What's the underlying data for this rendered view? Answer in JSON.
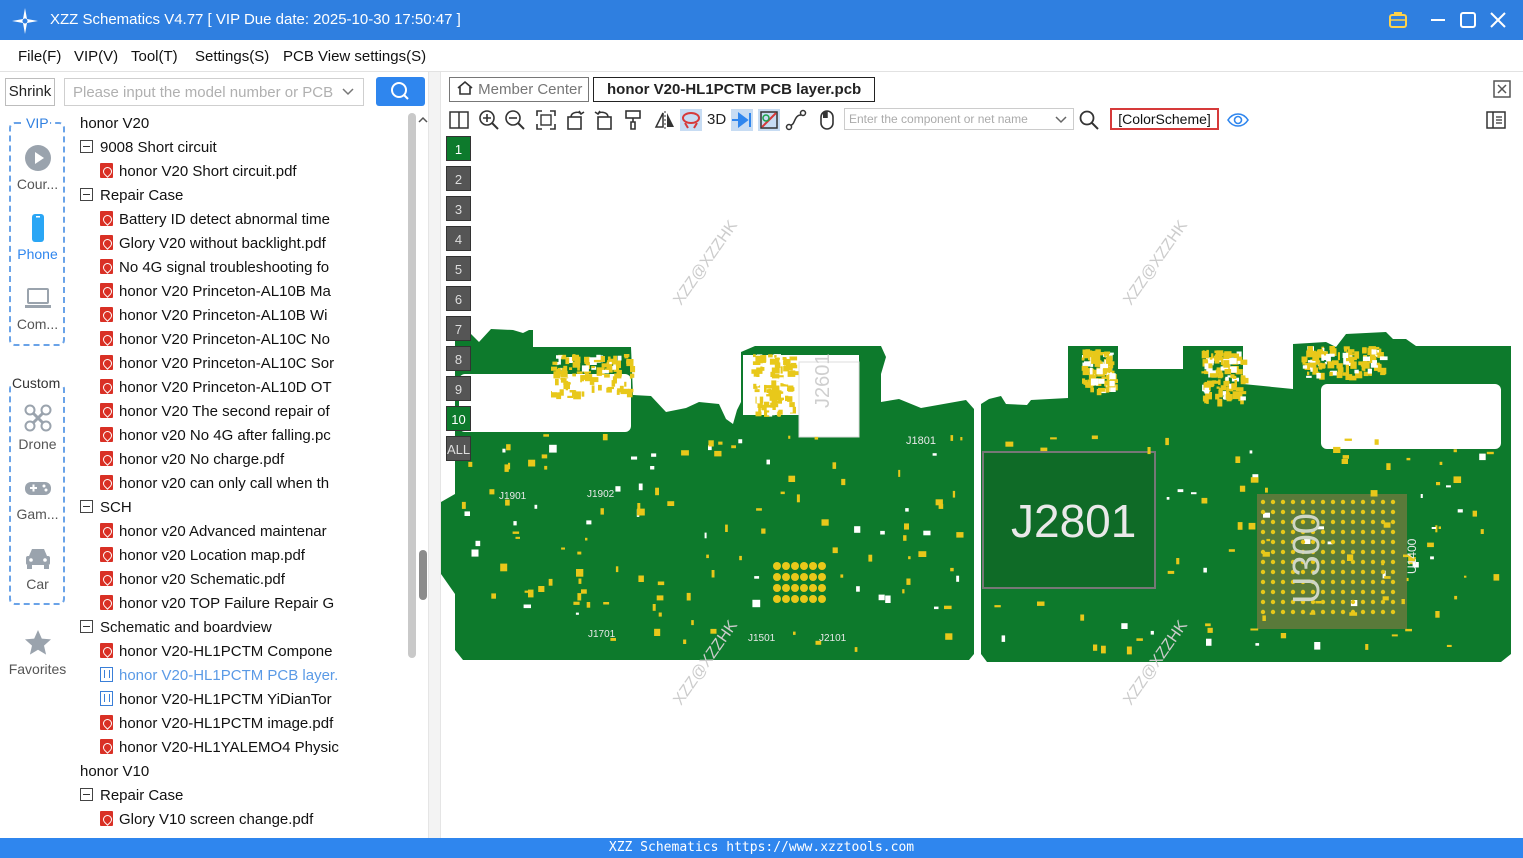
{
  "window": {
    "title": "XZZ Schematics V4.77 [ VIP Due date: 2025-10-30 17:50:47 ]"
  },
  "menu": {
    "file": "File(F)",
    "vip": "VIP(V)",
    "tool": "Tool(T)",
    "settings": "Settings(S)",
    "pcb_view": "PCB View settings(S)"
  },
  "sidebar": {
    "shrink_label": "Shrink",
    "search_placeholder": "Please input the model number or PCB",
    "vip_group_label": "VIP",
    "custom_group_label": "Custom",
    "items": [
      {
        "label": "Cour...",
        "icon": "play-icon"
      },
      {
        "label": "Phone",
        "icon": "phone-icon"
      },
      {
        "label": "Com...",
        "icon": "laptop-icon"
      },
      {
        "label": "Drone",
        "icon": "drone-icon"
      },
      {
        "label": "Gam...",
        "icon": "gamepad-icon"
      },
      {
        "label": "Car",
        "icon": "car-icon"
      },
      {
        "label": "Favorites",
        "icon": "star-icon"
      }
    ]
  },
  "tree": [
    {
      "label": "honor V20",
      "type": "folder",
      "level": 0
    },
    {
      "label": "9008 Short circuit",
      "type": "folder",
      "level": 1
    },
    {
      "label": "honor V20 Short circuit.pdf",
      "type": "pdf",
      "level": 2
    },
    {
      "label": "Repair Case",
      "type": "folder",
      "level": 1
    },
    {
      "label": "Battery ID detect abnormal time",
      "type": "pdf",
      "level": 2
    },
    {
      "label": "Glory V20 without backlight.pdf",
      "type": "pdf",
      "level": 2
    },
    {
      "label": "No 4G signal troubleshooting fo",
      "type": "pdf",
      "level": 2
    },
    {
      "label": "honor V20 Princeton-AL10B Ma",
      "type": "pdf",
      "level": 2
    },
    {
      "label": "honor V20 Princeton-AL10B Wi",
      "type": "pdf",
      "level": 2
    },
    {
      "label": "honor V20 Princeton-AL10C No",
      "type": "pdf",
      "level": 2
    },
    {
      "label": "honor V20 Princeton-AL10C Sor",
      "type": "pdf",
      "level": 2
    },
    {
      "label": "honor V20 Princeton-AL10D OT",
      "type": "pdf",
      "level": 2
    },
    {
      "label": "honor V20 The second repair of",
      "type": "pdf",
      "level": 2
    },
    {
      "label": "honor v20 No 4G after falling.pc",
      "type": "pdf",
      "level": 2
    },
    {
      "label": "honor v20 No charge.pdf",
      "type": "pdf",
      "level": 2
    },
    {
      "label": "honor v20 can only call when th",
      "type": "pdf",
      "level": 2
    },
    {
      "label": "SCH",
      "type": "folder",
      "level": 1
    },
    {
      "label": "honor v20 Advanced maintenar",
      "type": "pdf",
      "level": 2
    },
    {
      "label": "honor v20 Location map.pdf",
      "type": "pdf",
      "level": 2
    },
    {
      "label": "honor v20 Schematic.pdf",
      "type": "pdf",
      "level": 2
    },
    {
      "label": "honor v20 TOP Failure Repair G",
      "type": "pdf",
      "level": 2
    },
    {
      "label": "Schematic and boardview",
      "type": "folder",
      "level": 1
    },
    {
      "label": "honor V20-HL1PCTM Compone",
      "type": "pdf",
      "level": 2
    },
    {
      "label": "honor V20-HL1PCTM PCB layer.",
      "type": "pcb",
      "level": 2,
      "selected": true
    },
    {
      "label": "honor V20-HL1PCTM YiDianTor",
      "type": "pcb",
      "level": 2
    },
    {
      "label": "honor V20-HL1PCTM image.pdf",
      "type": "pdf",
      "level": 2
    },
    {
      "label": "honor V20-HL1YALEMO4 Physic",
      "type": "pdf",
      "level": 2
    },
    {
      "label": "honor V10",
      "type": "folder",
      "level": 0
    },
    {
      "label": "Repair Case",
      "type": "folder",
      "level": 1
    },
    {
      "label": "Glory V10 screen change.pdf",
      "type": "pdf",
      "level": 2
    }
  ],
  "tabs": {
    "member_center": "Member Center",
    "active_file": "honor V20-HL1PCTM PCB layer.pcb"
  },
  "toolbar": {
    "three_d": "3D",
    "component_search_placeholder": "Enter the component or net name",
    "color_scheme": "[ColorScheme]"
  },
  "layers": [
    "1",
    "2",
    "3",
    "4",
    "5",
    "6",
    "7",
    "8",
    "9",
    "10",
    "ALL"
  ],
  "board_labels": {
    "big_left": "J2801",
    "soc": "U300",
    "side": "J2601",
    "small": [
      "J1801",
      "J1901",
      "J1902",
      "J1701",
      "J1501",
      "J2101",
      "U1400"
    ]
  },
  "watermark": "XZZ@XZZHK",
  "status": {
    "text": "XZZ Schematics https://www.xzztools.com"
  },
  "colors": {
    "titlebar": "#2f7fe0",
    "board": "#0d7a2c",
    "pad": "#e8c81a",
    "selected": "#5a9ae6"
  }
}
